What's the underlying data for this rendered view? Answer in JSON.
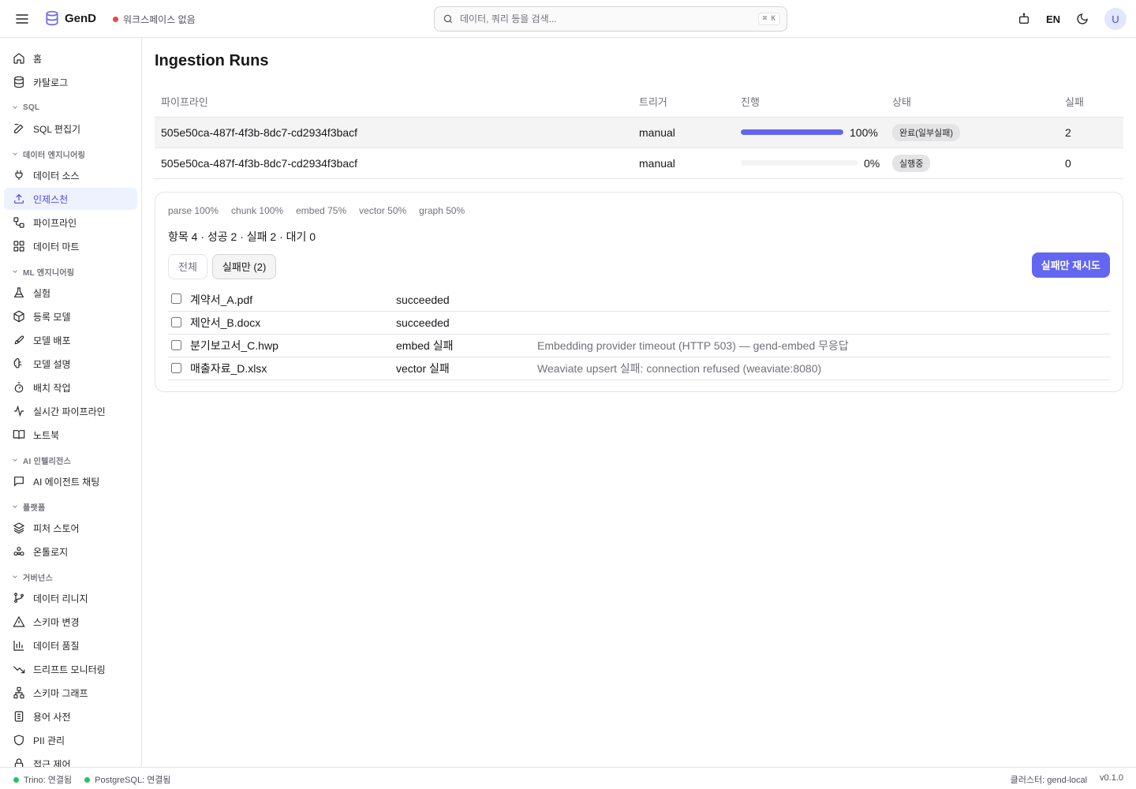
{
  "app": {
    "name": "GenD"
  },
  "header": {
    "workspace_status": "워크스페이스 없음",
    "search_placeholder": "데이터, 쿼리 등을 검색...",
    "search_shortcut": "⌘ K",
    "language": "EN",
    "avatar_initial": "U"
  },
  "sidebar": {
    "top": [
      {
        "label": "홈",
        "icon": "home-icon"
      },
      {
        "label": "카탈로그",
        "icon": "database-icon"
      }
    ],
    "sections": [
      {
        "title": "SQL",
        "items": [
          {
            "label": "SQL 편집기",
            "icon": "edit-icon"
          }
        ]
      },
      {
        "title": "데이터 엔지니어링",
        "items": [
          {
            "label": "데이터 소스",
            "icon": "plug-icon"
          },
          {
            "label": "인제스천",
            "icon": "upload-icon",
            "active": true
          },
          {
            "label": "파이프라인",
            "icon": "workflow-icon"
          },
          {
            "label": "데이터 마트",
            "icon": "grid-icon"
          }
        ]
      },
      {
        "title": "ML 엔지니어링",
        "items": [
          {
            "label": "실험",
            "icon": "flask-icon"
          },
          {
            "label": "등록 모델",
            "icon": "package-icon"
          },
          {
            "label": "모델 배포",
            "icon": "rocket-icon"
          },
          {
            "label": "모델 설명",
            "icon": "brain-icon"
          },
          {
            "label": "배치 작업",
            "icon": "timer-icon"
          },
          {
            "label": "실시간 파이프라인",
            "icon": "activity-icon"
          },
          {
            "label": "노트북",
            "icon": "book-icon"
          }
        ]
      },
      {
        "title": "AI 인텔리전스",
        "items": [
          {
            "label": "AI 에이전트 채팅",
            "icon": "chat-icon"
          }
        ]
      },
      {
        "title": "플랫폼",
        "items": [
          {
            "label": "피처 스토어",
            "icon": "layers-icon"
          },
          {
            "label": "온톨로지",
            "icon": "network-icon"
          }
        ]
      },
      {
        "title": "거버넌스",
        "items": [
          {
            "label": "데이터 리니지",
            "icon": "git-branch-icon"
          },
          {
            "label": "스키마 변경",
            "icon": "warning-icon"
          },
          {
            "label": "데이터 품질",
            "icon": "bar-chart-icon"
          },
          {
            "label": "드리프트 모니터링",
            "icon": "trend-down-icon"
          },
          {
            "label": "스키마 그래프",
            "icon": "hierarchy-icon"
          },
          {
            "label": "용어 사전",
            "icon": "document-icon"
          },
          {
            "label": "PII 관리",
            "icon": "shield-icon"
          },
          {
            "label": "접근 제어",
            "icon": "lock-icon"
          }
        ]
      }
    ]
  },
  "main": {
    "title": "Ingestion Runs",
    "columns": [
      "파이프라인",
      "트리거",
      "진행",
      "상태",
      "실패"
    ],
    "runs": [
      {
        "pipeline": "505e50ca-487f-4f3b-8dc7-cd2934f3bacf",
        "trigger": "manual",
        "progress": 100,
        "progress_label": "100%",
        "status": "완료(일부실패)",
        "failures": "2"
      },
      {
        "pipeline": "505e50ca-487f-4f3b-8dc7-cd2934f3bacf",
        "trigger": "manual",
        "progress": 0,
        "progress_label": "0%",
        "status": "실행중",
        "failures": "0"
      }
    ],
    "detail": {
      "stages": [
        "parse 100%",
        "chunk 100%",
        "embed 75%",
        "vector 50%",
        "graph 50%"
      ],
      "summary": "항목 4 · 성공 2 · 실패 2 · 대기 0",
      "filter_all": "전체",
      "filter_failed": "실패만 (2)",
      "retry_label": "실패만 재시도",
      "items": [
        {
          "name": "계약서_A.pdf",
          "status": "succeeded",
          "error": ""
        },
        {
          "name": "제안서_B.docx",
          "status": "succeeded",
          "error": ""
        },
        {
          "name": "분기보고서_C.hwp",
          "status": "embed 실패",
          "error": "Embedding provider timeout (HTTP 503) — gend-embed 무응답"
        },
        {
          "name": "매출자료_D.xlsx",
          "status": "vector 실패",
          "error": "Weaviate upsert 실패: connection refused (weaviate:8080)"
        }
      ]
    }
  },
  "footer": {
    "trino": "Trino: 연결됨",
    "postgres": "PostgreSQL: 연결됨",
    "cluster": "클러스터: gend-local",
    "version": "v0.1.0"
  },
  "colors": {
    "accent": "#6366f1",
    "danger": "#ef4444",
    "ok": "#22c55e"
  }
}
